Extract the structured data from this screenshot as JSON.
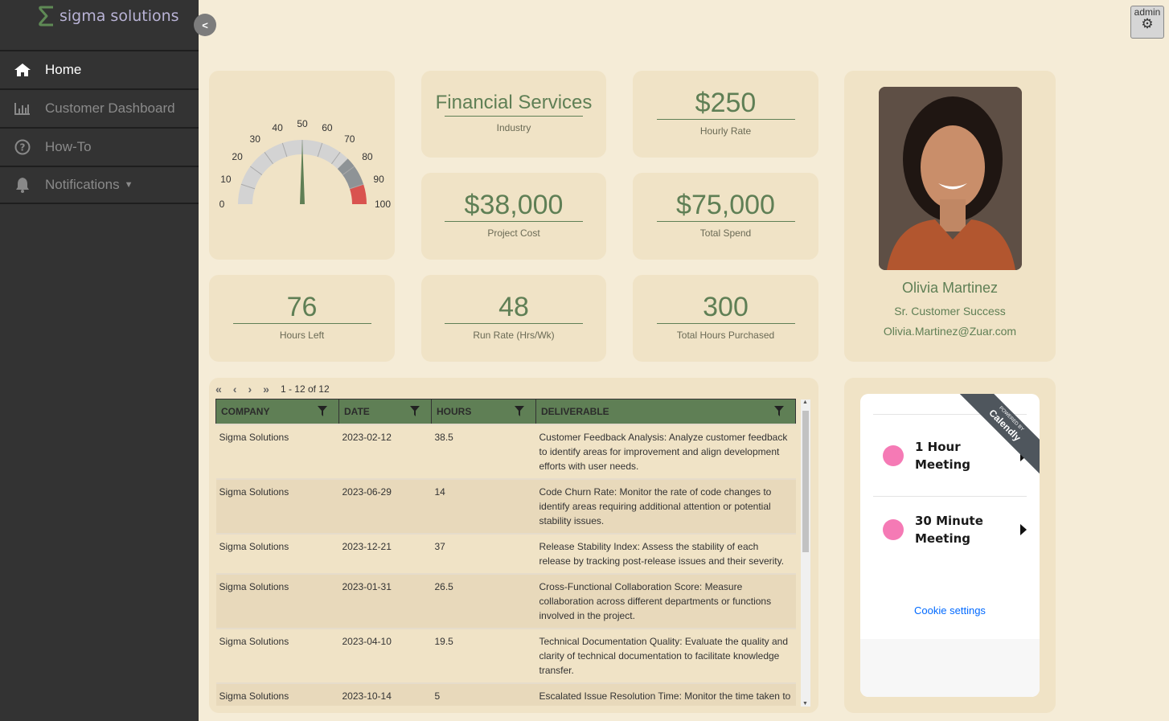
{
  "app": {
    "logo_text": "sigma solutions",
    "admin_label": "admin"
  },
  "sidebar": {
    "items": [
      {
        "label": "Home",
        "icon": "home-icon",
        "active": true
      },
      {
        "label": "Customer Dashboard",
        "icon": "bar-chart-icon"
      },
      {
        "label": "How-To",
        "icon": "question-circle-icon"
      },
      {
        "label": "Notifications",
        "icon": "bell-icon"
      }
    ]
  },
  "gauge": {
    "value": 50,
    "min": 0,
    "max": 100,
    "ticks": [
      "0",
      "10",
      "20",
      "30",
      "40",
      "50",
      "60",
      "70",
      "80",
      "90",
      "100"
    ],
    "bands": [
      {
        "from": 0,
        "to": 75,
        "color": "#d3d3d3"
      },
      {
        "from": 75,
        "to": 90,
        "color": "#8e9396"
      },
      {
        "from": 90,
        "to": 100,
        "color": "#d9534f"
      }
    ],
    "needle_color": "#5f7f55"
  },
  "kpis": {
    "industry": {
      "value": "Financial Services",
      "label": "Industry"
    },
    "hourly_rate": {
      "value": "$250",
      "label": "Hourly Rate"
    },
    "project_cost": {
      "value": "$38,000",
      "label": "Project Cost"
    },
    "total_spend": {
      "value": "$75,000",
      "label": "Total Spend"
    },
    "hours_left": {
      "value": "76",
      "label": "Hours Left"
    },
    "run_rate": {
      "value": "48",
      "label": "Run Rate (Hrs/Wk)"
    },
    "total_hours": {
      "value": "300",
      "label": "Total Hours Purchased"
    }
  },
  "profile": {
    "name": "Olivia Martinez",
    "title": "Sr. Customer Success",
    "email": "Olivia.Martinez@Zuar.com"
  },
  "table": {
    "pager": "1 - 12 of 12",
    "columns": [
      "COMPANY",
      "DATE",
      "HOURS",
      "DELIVERABLE"
    ],
    "rows": [
      [
        "Sigma Solutions",
        "2023-02-12",
        "38.5",
        "Customer Feedback Analysis: Analyze customer feedback to identify areas for improvement and align development efforts with user needs."
      ],
      [
        "Sigma Solutions",
        "2023-06-29",
        "14",
        "Code Churn Rate: Monitor the rate of code changes to identify areas requiring additional attention or potential stability issues."
      ],
      [
        "Sigma Solutions",
        "2023-12-21",
        "37",
        "Release Stability Index: Assess the stability of each release by tracking post-release issues and their severity."
      ],
      [
        "Sigma Solutions",
        "2023-01-31",
        "26.5",
        "Cross-Functional Collaboration Score: Measure collaboration across different departments or functions involved in the project."
      ],
      [
        "Sigma Solutions",
        "2023-04-10",
        "19.5",
        "Technical Documentation Quality: Evaluate the quality and clarity of technical documentation to facilitate knowledge transfer."
      ],
      [
        "Sigma Solutions",
        "2023-10-14",
        "5",
        "Escalated Issue Resolution Time: Monitor the time taken to resolve issues that have been escalated to higher levels of"
      ]
    ]
  },
  "calendly": {
    "powered_by": "POWERED BY",
    "brand": "Calendly",
    "events": [
      "1 Hour Meeting",
      "30 Minute Meeting"
    ],
    "cookie": "Cookie settings",
    "dot_color": "#f57ab5"
  },
  "colors": {
    "accent": "#5f7f55",
    "sidebar": "#333333",
    "background": "#f5ecd7",
    "card": "#f0e3c6"
  }
}
